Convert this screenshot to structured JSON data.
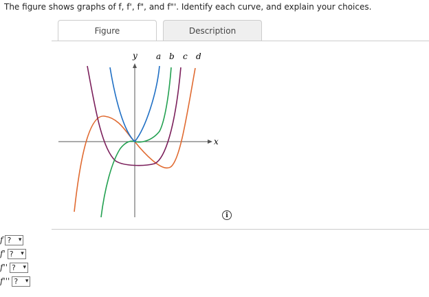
{
  "question": "The figure shows graphs of f, f', f\", and f\"'. Identify each curve, and explain your choices.",
  "tabs": [
    {
      "label": "Figure",
      "active": true
    },
    {
      "label": "Description",
      "active": false
    }
  ],
  "figure": {
    "y_label": "y",
    "x_label": "x",
    "curve_labels": [
      "a",
      "b",
      "c",
      "d"
    ],
    "curve_colors": {
      "a": "#1f6fc4",
      "b": "#22a050",
      "c": "#7a1e5a",
      "d": "#e06a30"
    }
  },
  "info_icon": "i",
  "answers": [
    {
      "label": "f",
      "value": "?"
    },
    {
      "label": "f'",
      "value": "?"
    },
    {
      "label": "f''",
      "value": "?"
    },
    {
      "label": "f'''",
      "value": "?"
    }
  ],
  "chevron": "▾"
}
